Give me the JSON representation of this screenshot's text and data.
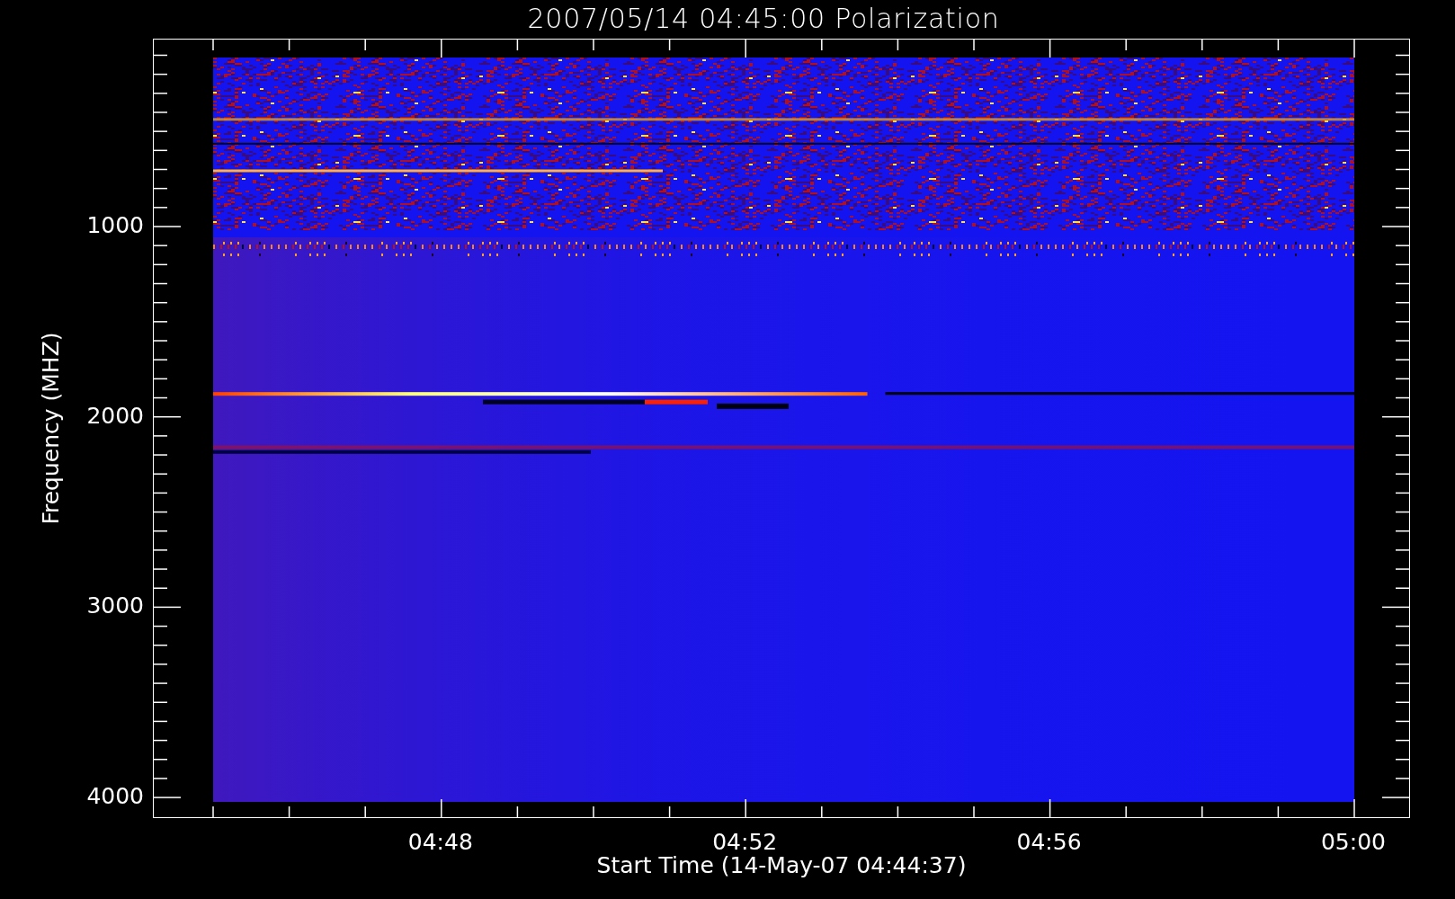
{
  "plot": {
    "title": "2007/05/14 04:45:00 Polarization",
    "ylabel": "Frequency (MHZ)",
    "xlabel": "Start Time (14-May-07 04:44:37)",
    "yticks": [
      "1000",
      "2000",
      "3000",
      "4000"
    ],
    "xticks": [
      "04:48",
      "04:52",
      "04:56",
      "05:00"
    ]
  }
}
